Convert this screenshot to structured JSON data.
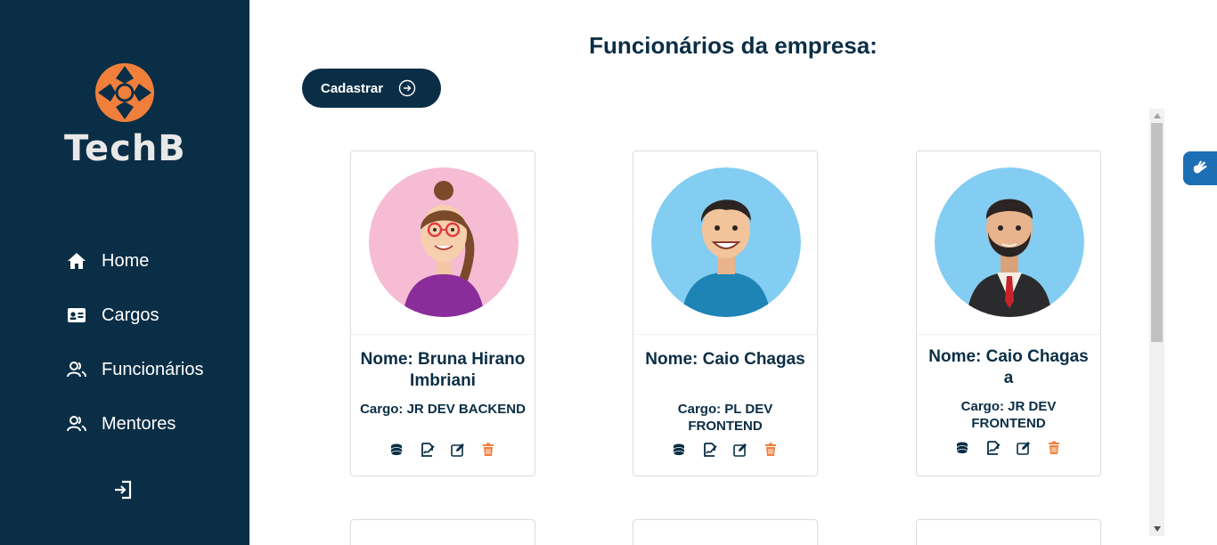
{
  "sidebar": {
    "logo_text": "TechB",
    "items": [
      {
        "label": "Home",
        "icon": "home-icon"
      },
      {
        "label": "Cargos",
        "icon": "id-card-icon"
      },
      {
        "label": "Funcionários",
        "icon": "users-icon"
      },
      {
        "label": "Mentores",
        "icon": "users-icon"
      }
    ],
    "logout_icon": "logout-icon"
  },
  "main": {
    "title": "Funcionários da empresa:",
    "cadastrar_label": "Cadastrar",
    "cards": [
      {
        "name": "Nome: Bruna Hirano Imbriani",
        "cargo": "Cargo: JR DEV BACKEND",
        "avatar": "woman-glasses-avatar"
      },
      {
        "name": "Nome: Caio Chagas",
        "cargo": "Cargo: PL DEV FRONTEND",
        "avatar": "man-tshirt-avatar"
      },
      {
        "name": "Nome: Caio Chagas a",
        "cargo": "Cargo: JR DEV FRONTEND",
        "avatar": "man-suit-avatar"
      }
    ],
    "card_actions": [
      "coins-icon",
      "signature-icon",
      "edit-icon",
      "trash-icon"
    ]
  },
  "colors": {
    "sidebar_bg": "#0a2e45",
    "primary": "#0a2e45",
    "accent": "#f07f3c",
    "a11y_widget": "#1d6fb5"
  }
}
